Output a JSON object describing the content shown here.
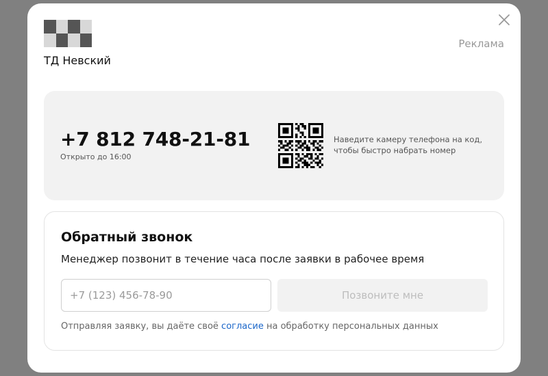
{
  "brand": {
    "name": "ТД Невский"
  },
  "ad_label": "Реклама",
  "contact": {
    "phone": "+7 812 748-21-81",
    "hours": "Открыто до 16:00",
    "qr_hint": "Наведите камеру телефона на код, чтобы быстро набрать номер"
  },
  "callback": {
    "title": "Обратный звонок",
    "subtitle": "Менеджер позвонит в течение часа после заявки в рабочее время",
    "phone_placeholder": "+7 (123) 456-78-90",
    "submit_label": "Позвоните мне",
    "consent_prefix": "Отправляя заявку, вы даёте своё ",
    "consent_link": "согласие",
    "consent_suffix": " на обработку персональных данных"
  },
  "icons": {
    "close": "close-icon",
    "qr": "qr-code-icon",
    "logo": "logo-placeholder"
  },
  "colors": {
    "overlay": "#808080",
    "link": "#1a66c9",
    "card_bg": "#f2f2f2"
  }
}
